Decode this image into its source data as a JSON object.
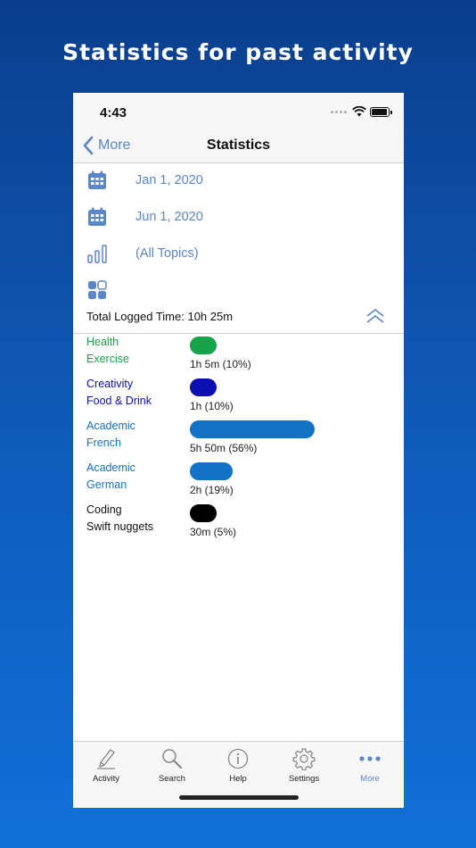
{
  "headline": "Statistics for past activity",
  "status_bar": {
    "time": "4:43"
  },
  "nav": {
    "back_label": "More",
    "title": "Statistics"
  },
  "filters": {
    "start_date": "Jan 1, 2020",
    "end_date": "Jun 1, 2020",
    "topics": "(All Topics)"
  },
  "total": "Total Logged Time: 10h 25m",
  "stats": [
    {
      "line1": "Health",
      "line2": "Exercise",
      "value": "1h 5m (10%)",
      "fraction": 0.1,
      "color": "#17a34a"
    },
    {
      "line1": "Creativity",
      "line2": "Food & Drink",
      "value": "1h (10%)",
      "fraction": 0.1,
      "color": "#0b0fb0"
    },
    {
      "line1": "Academic",
      "line2": "French",
      "value": "5h 50m (56%)",
      "fraction": 0.56,
      "color": "#1272c8"
    },
    {
      "line1": "Academic",
      "line2": "German",
      "value": "2h (19%)",
      "fraction": 0.19,
      "color": "#1272c8"
    },
    {
      "line1": "Coding",
      "line2": "Swift nuggets",
      "value": "30m (5%)",
      "fraction": 0.05,
      "color": "#000000"
    }
  ],
  "tabs": [
    {
      "label": "Activity",
      "icon": "pencil-icon"
    },
    {
      "label": "Search",
      "icon": "magnifier-icon"
    },
    {
      "label": "Help",
      "icon": "info-icon"
    },
    {
      "label": "Settings",
      "icon": "gear-icon"
    },
    {
      "label": "More",
      "icon": "more-dots-icon",
      "active": true
    }
  ],
  "colors": {
    "accent": "#5b86c8",
    "background_top": "#0a3e8c",
    "background_bottom": "#1070d8"
  }
}
